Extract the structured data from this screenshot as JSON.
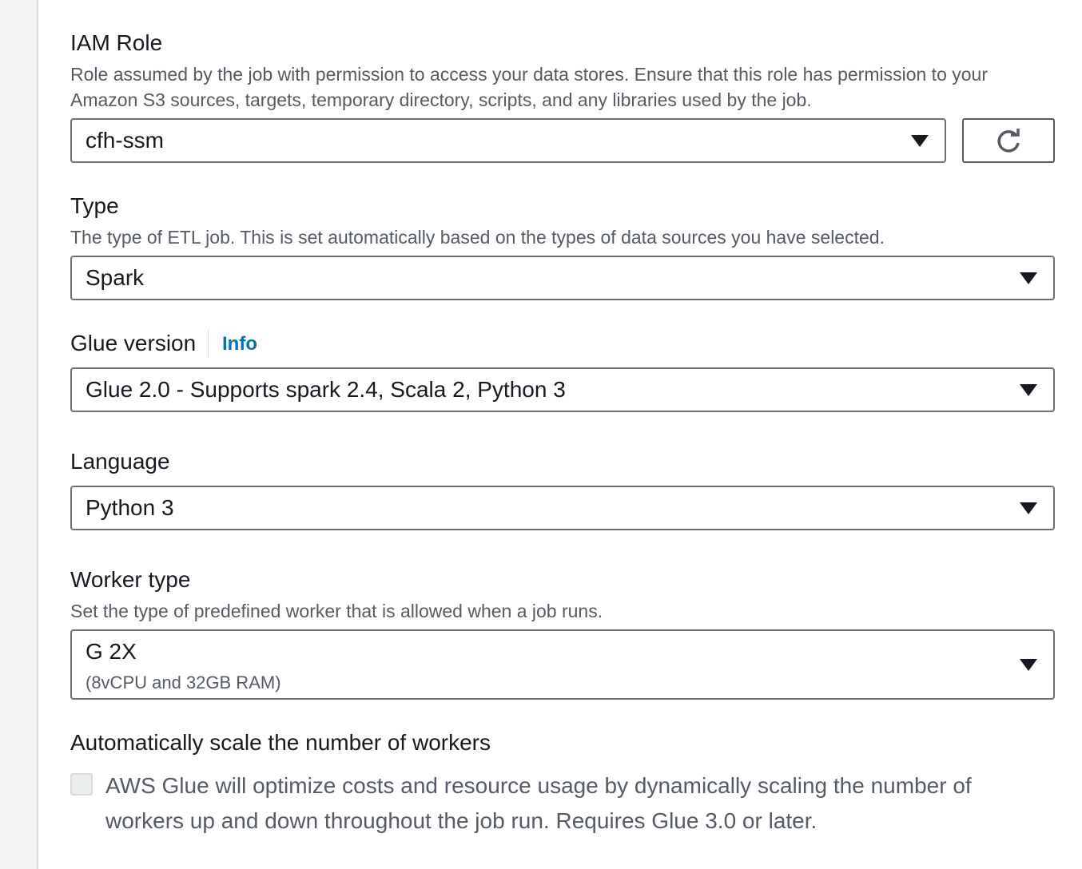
{
  "iam_role": {
    "label": "IAM Role",
    "description": "Role assumed by the job with permission to access your data stores. Ensure that this role has permission to your Amazon S3 sources, targets, temporary directory, scripts, and any libraries used by the job.",
    "value": "cfh-ssm",
    "refresh_icon": "refresh-icon"
  },
  "type": {
    "label": "Type",
    "description": "The type of ETL job. This is set automatically based on the types of data sources you have selected.",
    "value": "Spark"
  },
  "glue_version": {
    "label": "Glue version",
    "info_link": "Info",
    "value": "Glue 2.0 - Supports spark 2.4, Scala 2, Python 3"
  },
  "language": {
    "label": "Language",
    "value": "Python 3"
  },
  "worker_type": {
    "label": "Worker type",
    "description": "Set the type of predefined worker that is allowed when a job runs.",
    "value": "G 2X",
    "subvalue": "(8vCPU and 32GB RAM)"
  },
  "auto_scale": {
    "label": "Automatically scale the number of workers",
    "checkbox_text": "AWS Glue will optimize costs and resource usage by dynamically scaling the number of workers up and down throughout the job run. Requires Glue 3.0 or later.",
    "checked": false,
    "disabled": true
  },
  "colors": {
    "info_link": "#0073bb",
    "border": "#687078",
    "description_text": "#545b64"
  }
}
